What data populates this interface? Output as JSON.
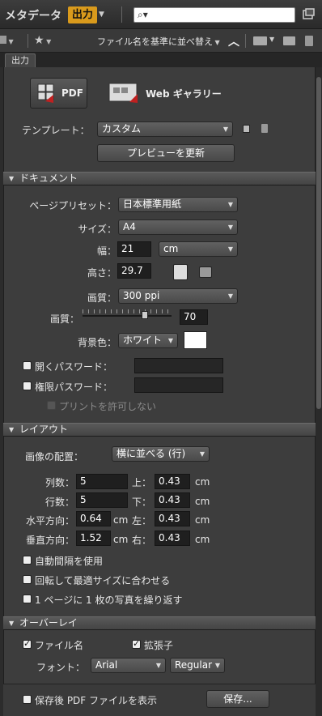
{
  "topbar": {
    "title": "メタデータ",
    "mode": "出力",
    "search_placeholder": ""
  },
  "toolbar": {
    "sort_label": "ファイル名を基準に並べ替え"
  },
  "tab": {
    "label": "出力"
  },
  "output_types": {
    "pdf": "PDF",
    "web": "Web ギャラリー"
  },
  "template": {
    "label": "テンプレート：",
    "value": "カスタム",
    "refresh": "プレビューを更新"
  },
  "document": {
    "header": "ドキュメント",
    "page_preset_label": "ページプリセット：",
    "page_preset": "日本標準用紙",
    "size_label": "サイズ：",
    "size": "A4",
    "width_label": "幅：",
    "width": "21",
    "unit": "cm",
    "height_label": "高さ：",
    "height": "29.7",
    "quality_label": "画質：",
    "quality": "300 ppi",
    "quality2_label": "画質：",
    "quality_slider_value": "70",
    "quality_slider_fraction": 0.7,
    "bg_label": "背景色：",
    "bg": "ホワイト",
    "open_pw_label": "開くパスワード：",
    "perm_pw_label": "権限パスワード：",
    "no_print_label": "プリントを許可しない"
  },
  "layout": {
    "header": "レイアウト",
    "placement_label": "画像の配置：",
    "placement": "横に並べる (行)",
    "cols_label": "列数：",
    "cols": "5",
    "rows_label": "行数：",
    "rows": "5",
    "hgap_label": "水平方向：",
    "hgap": "0.64",
    "vgap_label": "垂直方向：",
    "vgap": "1.52",
    "top_label": "上：",
    "top": "0.43",
    "bottom_label": "下：",
    "bottom": "0.43",
    "left_label": "左：",
    "left": "0.43",
    "right_label": "右：",
    "right": "0.43",
    "unit": "cm",
    "auto_spacing": "自動間隔を使用",
    "rotate_fit": "回転して最適サイズに合わせる",
    "repeat": "1 ページに 1 枚の写真を繰り返す"
  },
  "overlay": {
    "header": "オーバーレイ",
    "filename": "ファイル名",
    "extension": "拡張子",
    "font_label": "フォント：",
    "font": "Arial",
    "style": "Regular"
  },
  "bottom": {
    "show_pdf": "保存後 PDF ファイルを表示",
    "save": "保存..."
  }
}
